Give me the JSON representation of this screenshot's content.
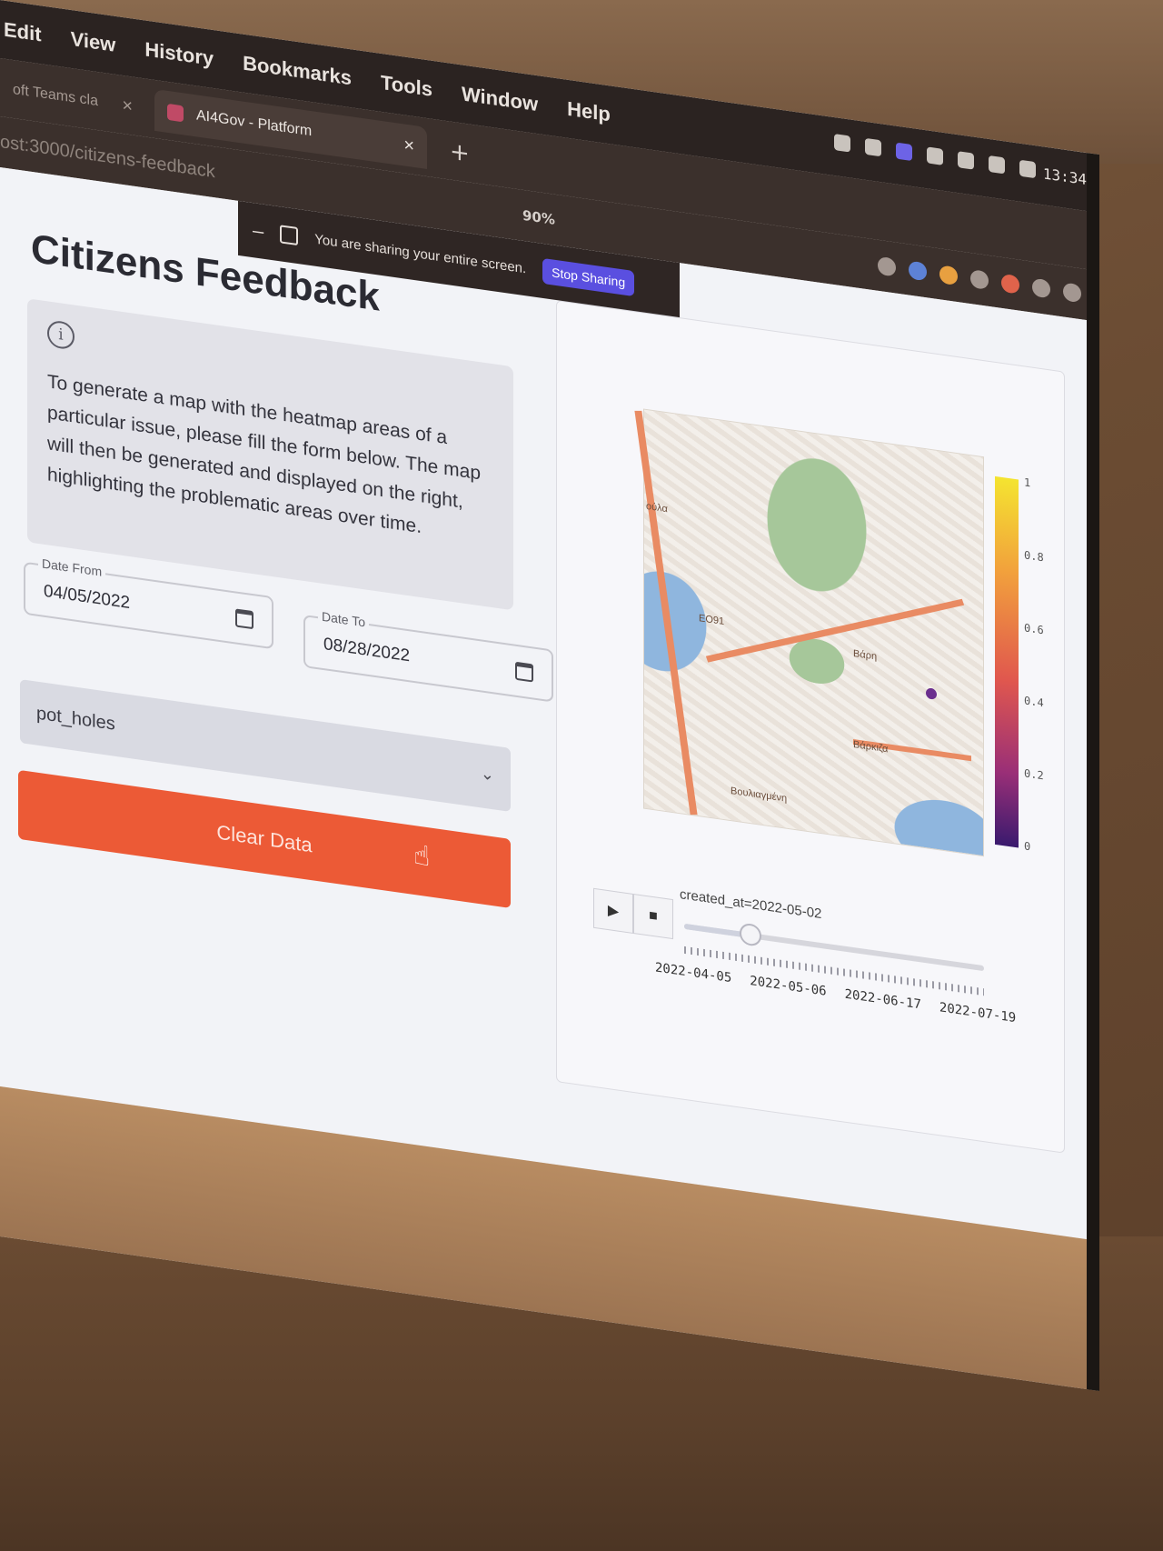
{
  "menu": [
    "Edit",
    "View",
    "History",
    "Bookmarks",
    "Tools",
    "Window",
    "Help"
  ],
  "clock": "13:34",
  "tabs": [
    {
      "label": "oft Teams cla"
    },
    {
      "label": "AI4Gov - Platform"
    }
  ],
  "url": "ost:3000/citizens-feedback",
  "zoom": "90%",
  "share_bar": {
    "message": "You are sharing your entire screen.",
    "stop_label": "Stop Sharing"
  },
  "page": {
    "title": "Citizens Feedback",
    "info_text": "To generate a map with the heatmap areas of a particular issue, please fill the form below. The map will then be generated and displayed on the right, highlighting the problematic areas over time."
  },
  "form": {
    "date_from_label": "Date From",
    "date_from_value": "04/05/2022",
    "date_to_label": "Date To",
    "date_to_value": "08/28/2022",
    "issue_value": "pot_holes",
    "clear_label": "Clear Data"
  },
  "map": {
    "labels": [
      "oύλα",
      "EO91",
      "Βάρη",
      "Βάρκιζα",
      "Βουλιαγμένη"
    ],
    "colorbar_ticks": [
      "1",
      "0.8",
      "0.6",
      "0.4",
      "0.2",
      "0"
    ],
    "colorbar_colors": [
      "#f4e430",
      "#f2a23c",
      "#e0574e",
      "#9a2f77",
      "#3a1a6e"
    ]
  },
  "animation": {
    "label": "created_at=2022-05-02",
    "position": 0.22,
    "tick_labels": [
      "2022-04-05",
      "2022-05-06",
      "2022-06-17",
      "2022-07-19"
    ],
    "play_icon": "play-icon",
    "stop_icon": "stop-icon"
  }
}
